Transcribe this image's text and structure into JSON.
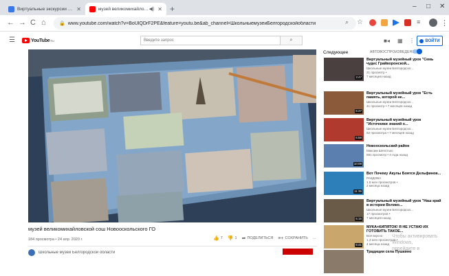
{
  "browser": {
    "tabs": [
      {
        "title": "Виртуальные экскурсии по муз",
        "active": false
      },
      {
        "title": "музей великомихайловско",
        "active": true
      }
    ],
    "new_tab": "+",
    "window_controls": [
      "–",
      "□",
      "✕"
    ],
    "url_host": "youtube.com",
    "url_full": "www.youtube.com/watch?v=BoUlQDrF2PE&feature=youtu.be&ab_channel=ШкольныемузеиБелгородскойобласти"
  },
  "youtube": {
    "logo_text": "YouTube",
    "logo_suffix": "RU",
    "search_placeholder": "Введите запрос",
    "sign_in": "ВОЙТИ"
  },
  "video": {
    "title": "музей великомихайловской сош Новооскольского ГО",
    "meta": "184 просмотра • 24 апр. 2020 г.",
    "likes": "7",
    "dislikes": "1",
    "share": "ПОДЕЛИТЬСЯ",
    "save": "СОХРАНИТЬ",
    "more": "...",
    "channel": "Школьные музеи Белгородской области"
  },
  "sidebar": {
    "up_next": "Следующее",
    "autoplay": "АВТОВОСПРОИЗВЕДЕНИЕ",
    "items": [
      {
        "title": "Виртуальный музейный урок \"Семь чудес Грайворонской...",
        "channel": "Школьные музеи Белгородско...",
        "views": "21 просмотр •",
        "age": "7 месяцев назад",
        "duration": "3:47",
        "thumb": "#4a4040"
      },
      {
        "title": "Виртуальный музейный урок \"Есть память, которой не...",
        "channel": "Школьные музеи Белгородско...",
        "views": "41 просмотр • 7 месяцев назад",
        "age": "",
        "duration": "6:27",
        "thumb": "#8a5a3a"
      },
      {
        "title": "Виртуальный музейный урок \"Источники знаний о...",
        "channel": "Школьные музеи Белгородско...",
        "views": "62 просмотра • 7 месяцев назад",
        "age": "",
        "duration": "6:58",
        "thumb": "#b03a2e"
      },
      {
        "title": "Новооскольский район",
        "channel": "Максим Шепотько",
        "views": "591 просмотр • 4 года назад",
        "age": "",
        "duration": "10:09",
        "thumb": "#5b7fae"
      },
      {
        "title": "Вот Почему Акулы Боятся Дельфинов...",
        "channel": "РАКДОВА",
        "views": "1,8 млн просмотров •",
        "age": "2 месяца назад",
        "duration": "11:35",
        "thumb": "#2c7fb8"
      },
      {
        "title": "Виртуальный музейный урок \"Наш край в истории Велико...",
        "channel": "Школьные музеи Белгородско...",
        "views": "17 просмотров •",
        "age": "7 месяцев назад",
        "duration": "6:15",
        "thumb": "#6a5a48"
      },
      {
        "title": "МУКА+КИПЯТОК! Я НЕ УСТАЮ ИХ ГОТОВИТЬ ТАКОЕ...",
        "channel": "Всё вкусно",
        "views": "1,3 млн просмотров •",
        "age": "4 месяца назад",
        "duration": "6:41",
        "thumb": "#c9a66b"
      },
      {
        "title": "Традиции села Пушкино",
        "channel": "",
        "views": "",
        "age": "",
        "duration": "",
        "thumb": "#8a7a6a"
      }
    ]
  },
  "overlay": {
    "activation_line1": "Чтобы активировать Windows,",
    "activation_line2": "перейдите в"
  }
}
